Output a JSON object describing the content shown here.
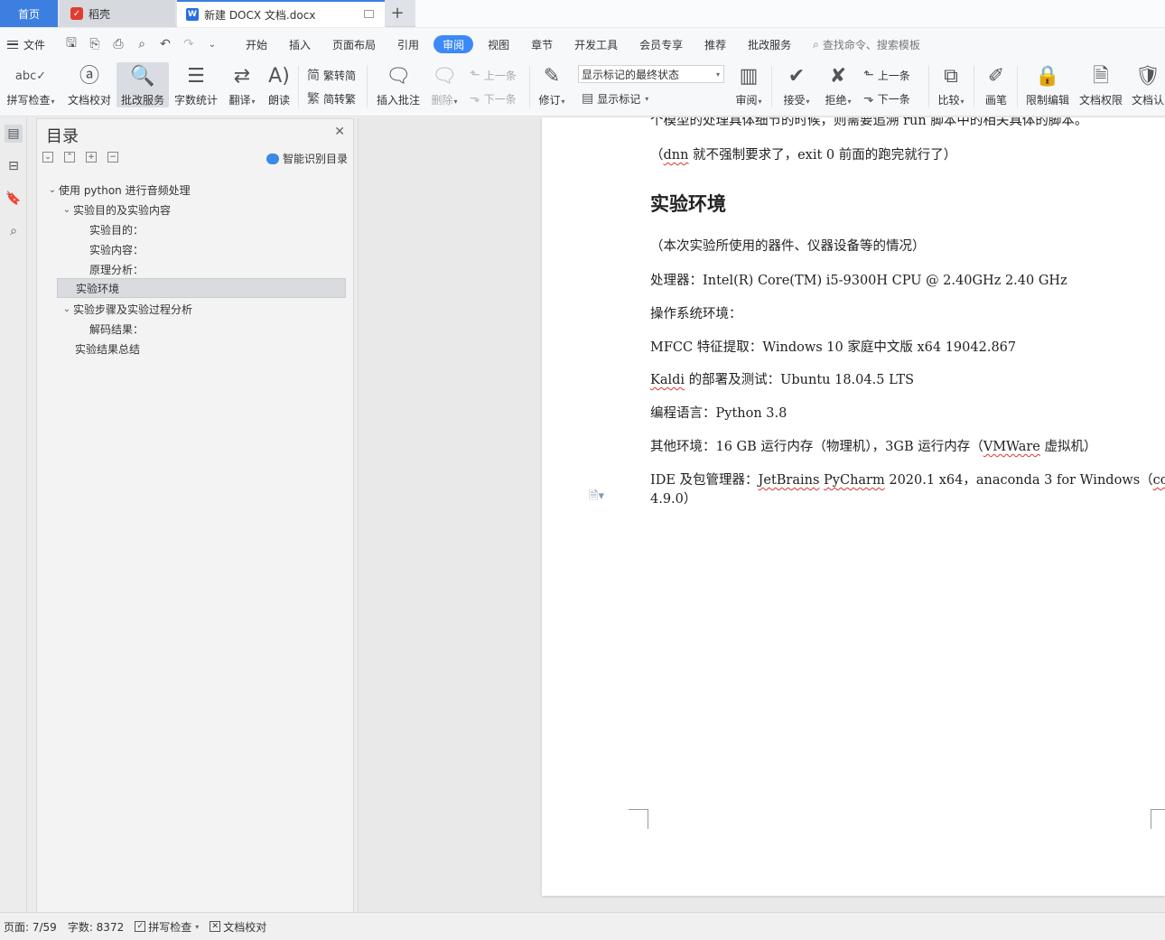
{
  "tabs": {
    "home": "首页",
    "daoke": "稻壳",
    "doc": "新建 DOCX 文档.docx",
    "add": "+"
  },
  "menu": {
    "file": "文件",
    "items": [
      "开始",
      "插入",
      "页面布局",
      "引用",
      "审阅",
      "视图",
      "章节",
      "开发工具",
      "会员专享",
      "推荐",
      "批改服务"
    ],
    "active": "审阅",
    "search": "查找命令、搜索模板"
  },
  "ribbon": {
    "spell": "拼写检查",
    "proofread": "文档校对",
    "correction": "批改服务",
    "wordcount": "字数统计",
    "translate": "翻译",
    "read_aloud": "朗读",
    "trad": "繁转简",
    "simp": "简转繁",
    "insert_comment": "插入批注",
    "delete": "删除",
    "prev": "上一条",
    "next": "下一条",
    "track": "修订",
    "markup_select": "显示标记的最终状态",
    "show_markup": "显示标记",
    "review": "审阅",
    "accept": "接受",
    "reject": "拒绝",
    "prev2": "上一条",
    "next2": "下一条",
    "compare": "比较",
    "pen": "画笔",
    "restrict": "限制编辑",
    "permission": "文档权限",
    "auth": "文档认"
  },
  "toc": {
    "title": "目录",
    "smart": "智能识别目录",
    "items": [
      "使用 python 进行音频处理",
      "实验目的及实验内容",
      "实验目的：",
      "实验内容：",
      "原理分析：",
      "实验环境",
      "实验步骤及实验过程分析",
      "解码结果：",
      "实验结果总结"
    ]
  },
  "doc": {
    "line_top": "个模型的处理具体细节的时候，则需要追溯 run 脚本中的相关具体的脚本。",
    "line_dnn_pre": "（",
    "line_dnn_word": "dnn",
    "line_dnn_post": " 就不强制要求了，exit 0  前面的跑完就行了）",
    "heading": "实验环境",
    "p1": "（本次实验所使用的器件、仪器设备等的情况）",
    "p2": "处理器：Intel(R) Core(TM) i5-9300H CPU @ 2.40GHz 2.40 GHz",
    "p3": "操作系统环境：",
    "p4": "MFCC  特征提取：Windows 10  家庭中文版  x64 19042.867",
    "p5_word": "Kaldi",
    "p5_post": " 的部署及测试：Ubuntu 18.04.5 LTS",
    "p6": "编程语言：Python 3.8",
    "p7_pre": "其他环境：16 GB  运行内存（物理机），3GB  运行内存（",
    "p7_word": "VMWare",
    "p7_post": " 虚拟机）",
    "p8_pre": "IDE  及包管理器：",
    "p8_word1": "JetBrains",
    "p8_sp": " ",
    "p8_word2": "PyCharm",
    "p8_mid": " 2020.1 x64，anaconda 3 for Windows（",
    "p8_word3": "conda",
    "p8_line2": "4.9.0）"
  },
  "status": {
    "page": "页面: 7/59",
    "words": "字数: 8372",
    "spell": "拼写检查",
    "proof": "文档校对"
  }
}
